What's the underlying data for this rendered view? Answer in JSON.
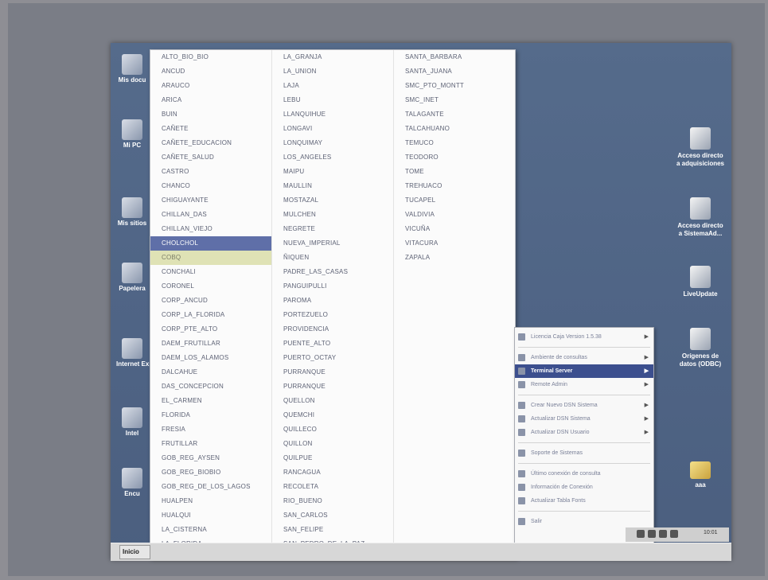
{
  "desktop": {
    "left_icons": [
      {
        "label": "Mis docu",
        "icon": "documents-icon"
      },
      {
        "label": "Mi PC",
        "icon": "computer-icon"
      },
      {
        "label": "Mis sitios",
        "icon": "network-icon"
      },
      {
        "label": "Papelera",
        "icon": "recycle-bin-icon"
      },
      {
        "label": "Internet Exp",
        "icon": "internet-explorer-icon"
      },
      {
        "label": "Intel",
        "icon": "program-icon"
      },
      {
        "label": "Encu",
        "icon": "program-icon"
      }
    ],
    "right_icons": [
      {
        "label": "Acceso directo a adquisiciones",
        "icon": "shortcut-icon"
      },
      {
        "label": "Acceso directo a SistemaAd...",
        "icon": "shortcut-icon"
      },
      {
        "label": "LiveUpdate",
        "icon": "liveupdate-icon"
      },
      {
        "label": "Orígenes de datos (ODBC)",
        "icon": "odbc-icon"
      },
      {
        "label": "aaa",
        "icon": "folder-icon"
      }
    ]
  },
  "menu": {
    "columns": [
      [
        "ALTO_BIO_BIO",
        "ANCUD",
        "ARAUCO",
        "ARICA",
        "BUIN",
        "CAÑETE",
        "CAÑETE_EDUCACION",
        "CAÑETE_SALUD",
        "CASTRO",
        "CHANCO",
        "CHIGUAYANTE",
        "CHILLAN_DAS",
        "CHILLAN_VIEJO",
        "CHOLCHOL",
        "COBQ",
        "CONCHALI",
        "CORONEL",
        "CORP_ANCUD",
        "CORP_LA_FLORIDA",
        "CORP_PTE_ALTO",
        "DAEM_FRUTILLAR",
        "DAEM_LOS_ALAMOS",
        "DALCAHUE",
        "DAS_CONCEPCION",
        "EL_CARMEN",
        "FLORIDA",
        "FRESIA",
        "FRUTILLAR",
        "GOB_REG_AYSEN",
        "GOB_REG_BIOBIO",
        "GOB_REG_DE_LOS_LAGOS",
        "HUALPEN",
        "HUALQUI",
        "LA_CISTERNA",
        "LA_FLORIDA"
      ],
      [
        "LA_GRANJA",
        "LA_UNION",
        "LAJA",
        "LEBU",
        "LLANQUIHUE",
        "LONGAVI",
        "LONQUIMAY",
        "LOS_ANGELES",
        "MAIPU",
        "MAULLIN",
        "MOSTAZAL",
        "MULCHEN",
        "NEGRETE",
        "NUEVA_IMPERIAL",
        "ÑIQUEN",
        "PADRE_LAS_CASAS",
        "PANGUIPULLI",
        "PAROMA",
        "PORTEZUELO",
        "PROVIDENCIA",
        "PUENTE_ALTO",
        "PUERTO_OCTAY",
        "PURRANQUE",
        "PURRANQUE",
        "QUELLON",
        "QUEMCHI",
        "QUILLECO",
        "QUILLON",
        "QUILPUE",
        "RANCAGUA",
        "RECOLETA",
        "RIO_BUENO",
        "SAN_CARLOS",
        "SAN_FELIPE",
        "SAN_PEDRO_DE_LA_PAZ"
      ],
      [
        "SANTA_BARBARA",
        "SANTA_JUANA",
        "SMC_PTO_MONTT",
        "SMC_INET",
        "TALAGANTE",
        "TALCAHUANO",
        "TEMUCO",
        "TEODORO",
        "TOME",
        "TREHUACO",
        "TUCAPEL",
        "VALDIVIA",
        "VICUÑA",
        "VITACURA",
        "ZAPALA"
      ]
    ],
    "highlighted": "CHOLCHOL",
    "hovered": "COBQ"
  },
  "context_menu": {
    "items": [
      {
        "label": "Licencia Caja Version 1.5.38",
        "icon": "app-icon",
        "arrow": true,
        "separator_after": true
      },
      {
        "label": "Ambiente de consultas",
        "icon": "database-icon",
        "arrow": true
      },
      {
        "label": "Terminal Server",
        "icon": "server-icon",
        "arrow": true,
        "highlighted": true
      },
      {
        "label": "Remote Admin",
        "icon": "remote-icon",
        "arrow": true,
        "separator_after": true
      },
      {
        "label": "Crear Nuevo DSN Sistema",
        "icon": "dsn-icon",
        "arrow": true
      },
      {
        "label": "Actualizar DSN Sistema",
        "icon": "dsn-icon",
        "arrow": true
      },
      {
        "label": "Actualizar DSN Usuario",
        "icon": "dsn-icon",
        "arrow": true,
        "separator_after": true
      },
      {
        "label": "Soporte de Sistemas",
        "icon": "support-icon",
        "arrow": false,
        "separator_after": true
      },
      {
        "label": "Último conexión de consulta",
        "icon": "connection-icon",
        "arrow": false
      },
      {
        "label": "Información de Conexión",
        "icon": "info-icon",
        "arrow": false
      },
      {
        "label": "Actualizar Tabla Fonts",
        "icon": "update-icon",
        "arrow": false,
        "separator_after": true
      },
      {
        "label": "Salir",
        "icon": "exit-icon",
        "arrow": false
      }
    ]
  },
  "taskbar": {
    "start_label": "Inicio",
    "clock": "10:01"
  }
}
